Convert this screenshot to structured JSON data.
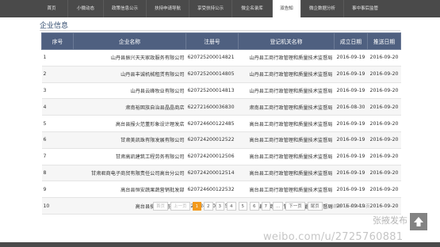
{
  "nav": {
    "items": [
      {
        "label": "首页",
        "active": false
      },
      {
        "label": "小微动态",
        "active": false
      },
      {
        "label": "政策信息公示",
        "active": false
      },
      {
        "label": "扶持申请导航",
        "active": false
      },
      {
        "label": "享受扶持公示",
        "active": false
      },
      {
        "label": "微企名录库",
        "active": false
      },
      {
        "label": "双告知",
        "active": true
      },
      {
        "label": "微企数据分析",
        "active": false
      },
      {
        "label": "事中事后监管",
        "active": false
      }
    ]
  },
  "section_title": "企业信息",
  "table": {
    "headers": [
      "序号",
      "企业名称",
      "注册号",
      "登记机关名称",
      "成立日期",
      "推送日期"
    ],
    "rows": [
      [
        "1",
        "山丹县振兴天天家政服务有限公司",
        "620725200014821",
        "山丹县工商行政管理和质量技术监督局",
        "2016-09-19",
        "2016-09-20"
      ],
      [
        "2",
        "山丹县丰诚机械租赁有限公司",
        "620725200014805",
        "山丹县工商行政管理和质量技术监督局",
        "2016-09-19",
        "2016-09-20"
      ],
      [
        "3",
        "山丹县云峰牧业有限公司",
        "620725200014813",
        "山丹县工商行政管理和质量技术监督局",
        "2016-09-19",
        "2016-09-20"
      ],
      [
        "4",
        "肃南裕固族自治县晶晶商店",
        "622721600036830",
        "肃南县工商行政管理和质量技术监督局",
        "2016-08-30",
        "2016-09-20"
      ],
      [
        "5",
        "高台县报火范董形象设计理发店",
        "620724600122485",
        "高台县工商行政管理和质量技术监督局",
        "2016-09-19",
        "2016-09-20"
      ],
      [
        "6",
        "甘肃美凯珠有限发展有限公司",
        "620724200012522",
        "高台县工商行政管理和质量技术监督局",
        "2016-09-19",
        "2016-09-20"
      ],
      [
        "7",
        "甘肃高凯建筑工程劳务有限公司",
        "620724200012506",
        "高台县工商行政管理和质量技术监督局",
        "2016-09-19",
        "2016-09-20"
      ],
      [
        "8",
        "甘肃君商电子商贸有限责任公司高台分公司",
        "620724200012514",
        "高台县工商行政管理和质量技术监督局",
        "2016-09-19",
        "2016-09-20"
      ],
      [
        "9",
        "高台县恒安蔬果蔬营销批发部",
        "620724600122532",
        "高台县工商行政管理和质量技术监督局",
        "2016-09-19",
        "2016-09-20"
      ],
      [
        "10",
        "高台县俊峰绳网批发部",
        "620724600122549",
        "高台县工商行政管理和质量技术监督局",
        "2016-09-19",
        "2016-09-20"
      ]
    ]
  },
  "pagination": {
    "first_label": "首页",
    "prev_label": "上一页",
    "pages": [
      "1",
      "2",
      "3",
      "4",
      "5",
      "6",
      "7"
    ],
    "current_page": "1",
    "ellipsis": "...",
    "next_label": "下一页",
    "last_label": "尾页",
    "info": "当前第 1页 共 3425页"
  },
  "watermark": {
    "user": "张掖发布",
    "url": "weibo.com/u/2725760881"
  },
  "colors": {
    "nav_bg": "#4a4a4a",
    "header_bg": "#4f6080",
    "current_page": "#f39a1d"
  }
}
